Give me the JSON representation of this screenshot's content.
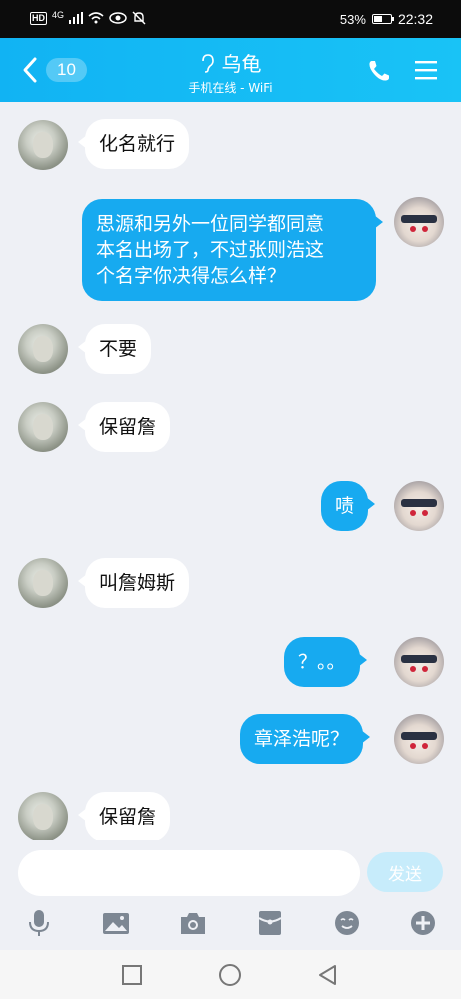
{
  "status_bar": {
    "left_badges": [
      "HD",
      "4G"
    ],
    "battery": "53%",
    "battery_level": 0.53,
    "time": "22:32"
  },
  "header": {
    "unread_count": "10",
    "contact_name": "乌龟",
    "status": "手机在线 - WiFi",
    "icons": [
      "back-chevron-icon",
      "ear-icon",
      "phone-icon",
      "menu-icon"
    ]
  },
  "messages": [
    {
      "side": "in",
      "text": "化名就行"
    },
    {
      "side": "out",
      "lines": [
        "思源和另外一位同学都同意",
        "本名出场了，不过张则浩这",
        "个名字你决得怎么样？"
      ]
    },
    {
      "side": "in",
      "text": "不要"
    },
    {
      "side": "in",
      "text": "保留詹"
    },
    {
      "side": "out",
      "text": "啧"
    },
    {
      "side": "in",
      "text": "叫詹姆斯"
    },
    {
      "side": "out",
      "text": "？。。"
    },
    {
      "side": "out",
      "text": "章泽浩呢？"
    },
    {
      "side": "in",
      "text": "保留詹"
    }
  ],
  "input": {
    "placeholder": "",
    "value": "",
    "send_label": "发送"
  },
  "toolbar": [
    "microphone-icon",
    "image-icon",
    "camera-icon",
    "red-packet-icon",
    "emoji-icon",
    "plus-icon"
  ],
  "nav": [
    "recents-square-icon",
    "home-circle-icon",
    "back-triangle-icon"
  ],
  "colors": {
    "header": "#19c3f6",
    "outgoing_bubble": "#17aaf0",
    "incoming_bubble": "#ffffff",
    "background": "#eef0f5",
    "send_button_disabled": "#c7ecfb"
  }
}
